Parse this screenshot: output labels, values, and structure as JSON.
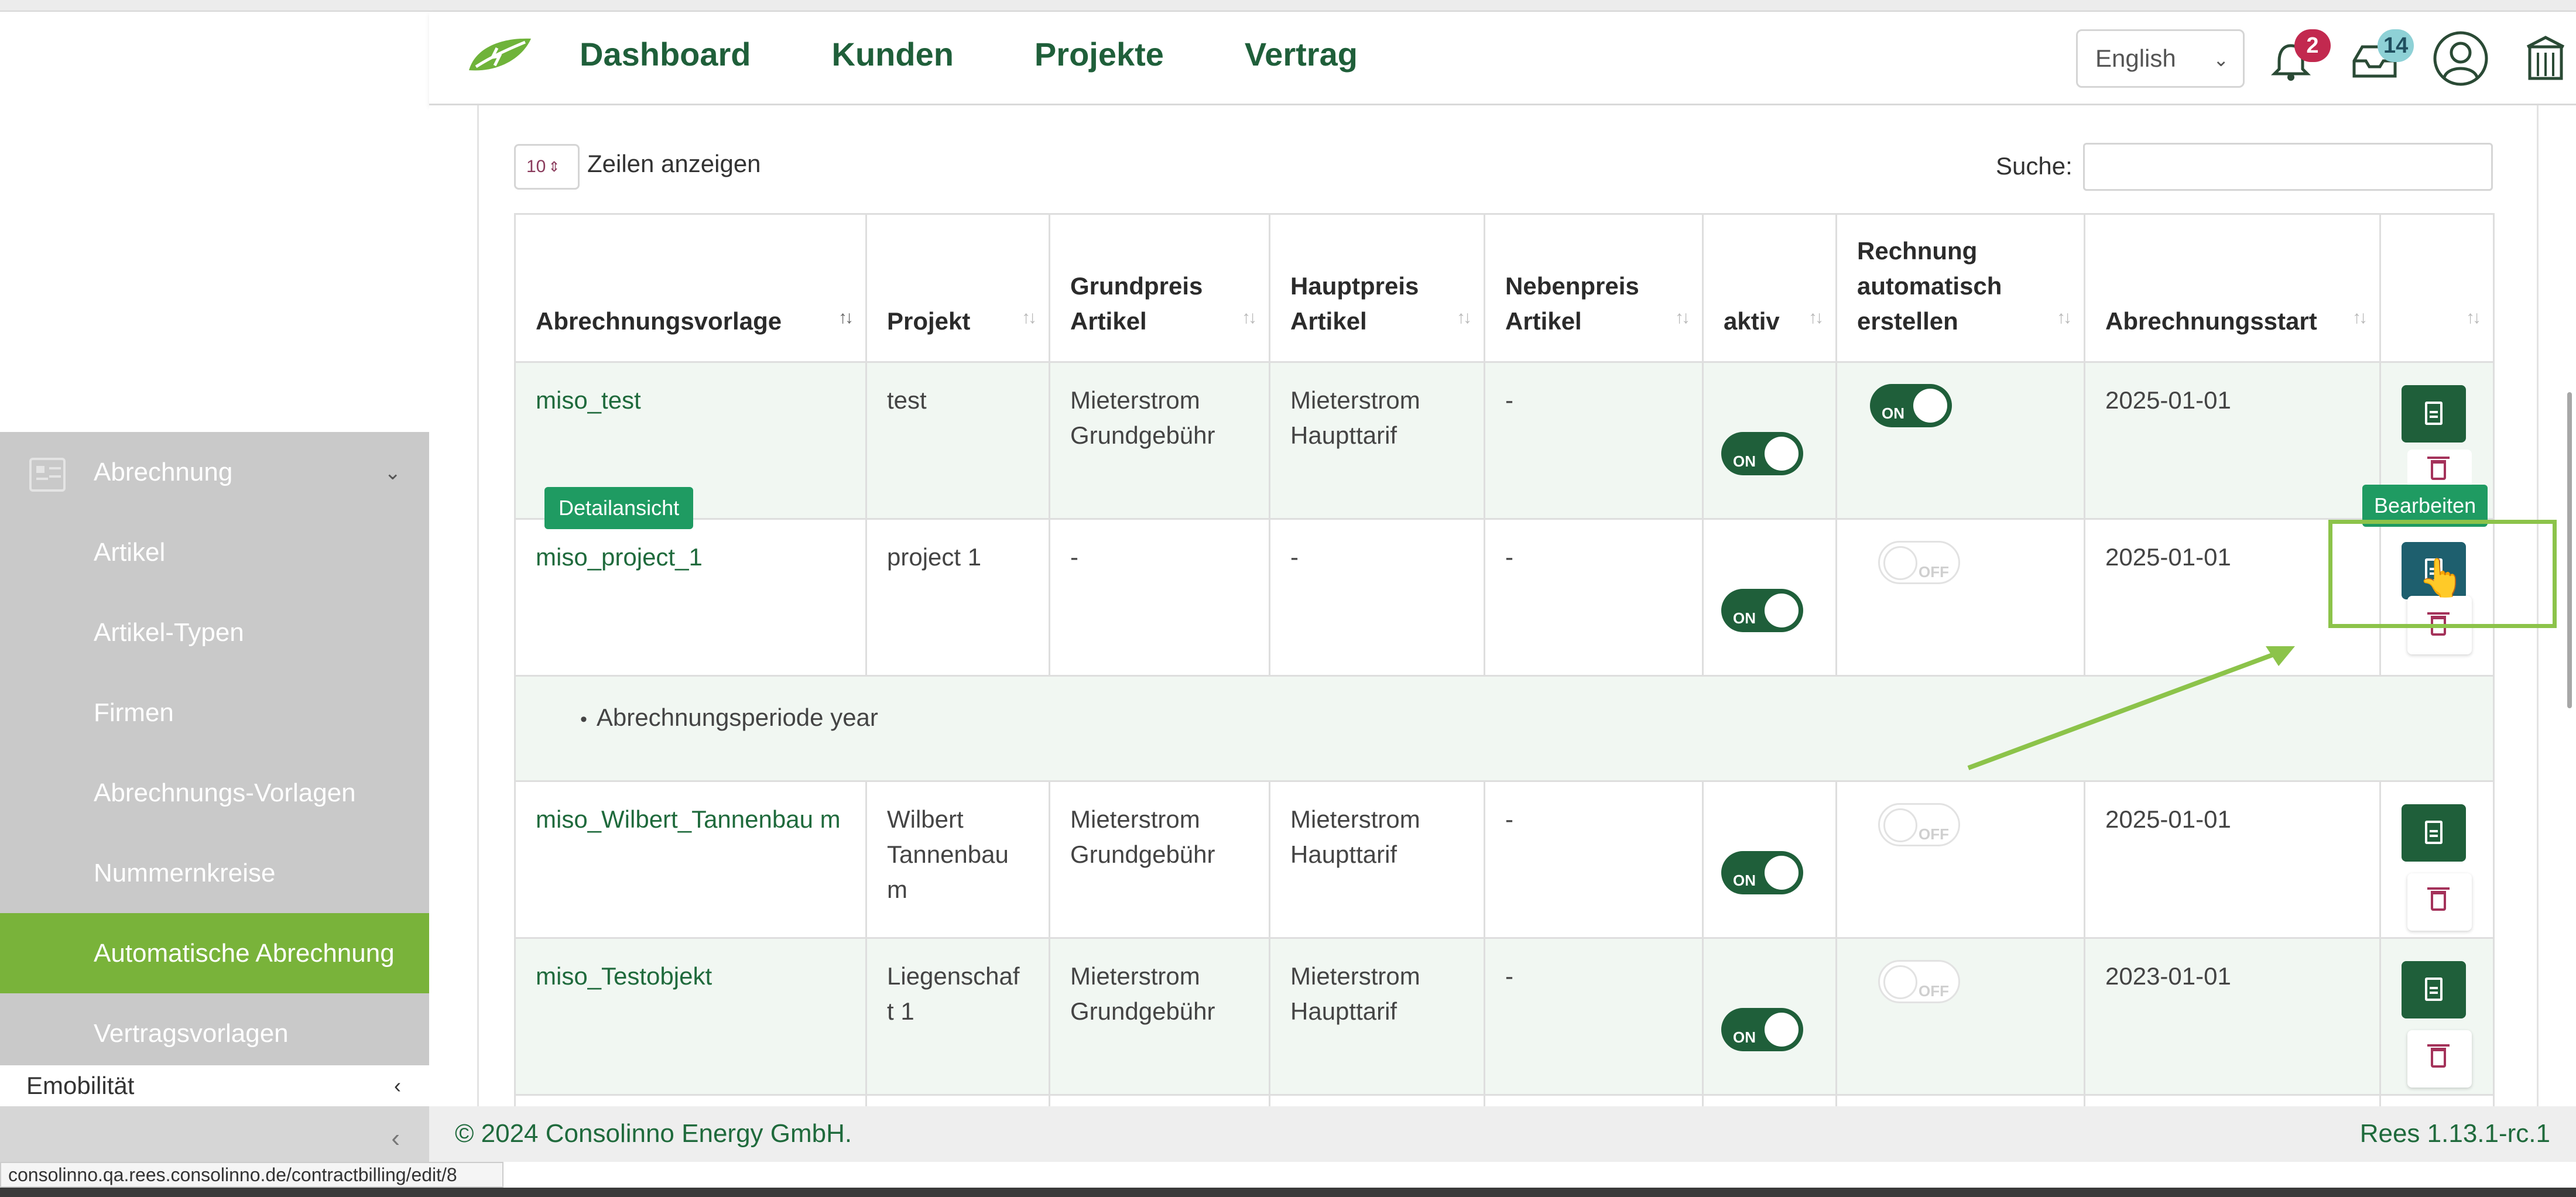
{
  "nav": {
    "items": [
      "Dashboard",
      "Kunden",
      "Projekte",
      "Vertrag"
    ]
  },
  "header": {
    "language": "English",
    "notifications_count": "2",
    "messages_count": "14"
  },
  "sidebar": {
    "section": "Abrechnung",
    "items": [
      "Artikel",
      "Artikel-Typen",
      "Firmen",
      "Abrechnungs-Vorlagen",
      "Nummernkreise",
      "Automatische Abrechnung",
      "Vertragsvorlagen"
    ],
    "active_item": "Automatische Abrechnung",
    "next_section": "Emobilität"
  },
  "table_controls": {
    "page_length": "10",
    "length_label": "Zeilen anzeigen",
    "search_label": "Suche:"
  },
  "table": {
    "columns": [
      "Abrechnungsvorlage",
      "Projekt",
      "Grundpreis Artikel",
      "Hauptpreis Artikel",
      "Nebenpreis Artikel",
      "aktiv",
      "Rechnung automatisch erstellen",
      "Abrechnungsstart",
      ""
    ],
    "rows": [
      {
        "name": "miso_test",
        "projekt": "test",
        "grundpreis": "Mieterstrom Grundgebühr",
        "hauptpreis": "Mieterstrom Haupttarif",
        "nebenpreis": "-",
        "aktiv": "ON",
        "auto": "ON",
        "start": "2025-01-01"
      },
      {
        "name": "miso_project_1",
        "projekt": "project 1",
        "grundpreis": "-",
        "hauptpreis": "-",
        "nebenpreis": "-",
        "aktiv": "ON",
        "auto": "OFF",
        "start": "2025-01-01"
      },
      {
        "name": "miso_Wilbert_Tannenbau m",
        "projekt": "Wilbert Tannenbau m",
        "grundpreis": "Mieterstrom Grundgebühr",
        "hauptpreis": "Mieterstrom Haupttarif",
        "nebenpreis": "-",
        "aktiv": "ON",
        "auto": "OFF",
        "start": "2025-01-01"
      },
      {
        "name": "miso_Testobjekt",
        "projekt": "Liegenschaf t 1",
        "grundpreis": "Mieterstrom Grundgebühr",
        "hauptpreis": "Mieterstrom Haupttarif",
        "nebenpreis": "-",
        "aktiv": "ON",
        "auto": "OFF",
        "start": "2023-01-01"
      }
    ],
    "detail_row": "Abrechnungsperiode year"
  },
  "tooltips": {
    "detail": "Detailansicht",
    "edit": "Bearbeiten"
  },
  "footer": {
    "copyright": "© 2024 Consolinno Energy GmbH.",
    "version": "Rees 1.13.1-rc.1"
  },
  "status_url": "consolinno.qa.rees.consolinno.de/contractbilling/edit/8",
  "colors": {
    "brand_green": "#1f5f3a",
    "accent_green": "#79b33a",
    "highlight": "#8cc34a",
    "delete": "#a4325a"
  }
}
